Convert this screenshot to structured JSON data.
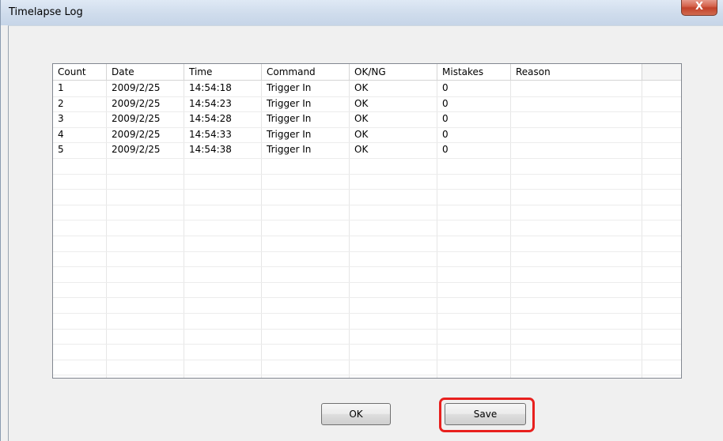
{
  "window": {
    "title": "Timelapse Log",
    "close_label": "X"
  },
  "table": {
    "columns": [
      "Count",
      "Date",
      "Time",
      "Command",
      "OK/NG",
      "Mistakes",
      "Reason"
    ],
    "rows": [
      [
        "1",
        "2009/2/25",
        "14:54:18",
        "Trigger In",
        "OK",
        "0",
        ""
      ],
      [
        "2",
        "2009/2/25",
        "14:54:23",
        "Trigger In",
        "OK",
        "0",
        ""
      ],
      [
        "3",
        "2009/2/25",
        "14:54:28",
        "Trigger In",
        "OK",
        "0",
        ""
      ],
      [
        "4",
        "2009/2/25",
        "14:54:33",
        "Trigger In",
        "OK",
        "0",
        ""
      ],
      [
        "5",
        "2009/2/25",
        "14:54:38",
        "Trigger In",
        "OK",
        "0",
        ""
      ]
    ]
  },
  "buttons": {
    "ok_label": "OK",
    "save_label": "Save"
  },
  "colors": {
    "highlight": "#e8201e",
    "close_button": "#c2412a"
  }
}
